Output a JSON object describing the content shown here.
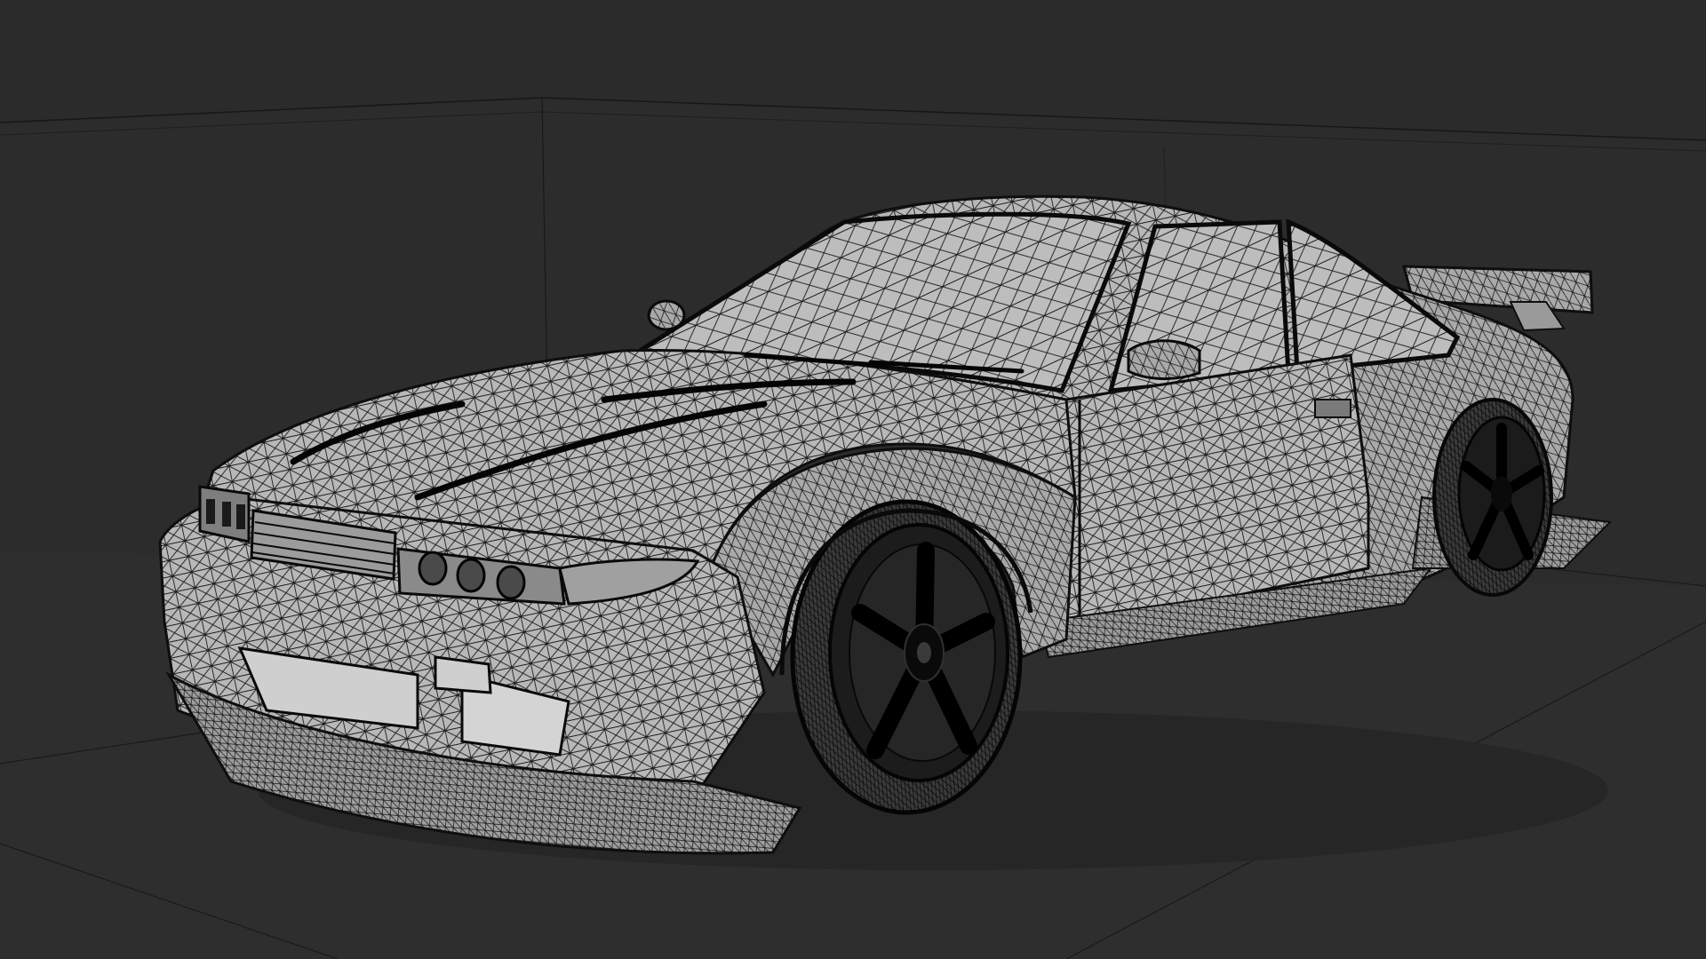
{
  "viewport": {
    "background_color": "#2b2b2b",
    "ground_color": "#2f2f2f",
    "grid_line_color": "#171717",
    "grid_minor_color": "#303030",
    "shading_mode": "wireframe-overlay-solid",
    "object": {
      "kind": "car-model",
      "body_color": "#b6b6b6",
      "wire_color": "#111111",
      "tire_color": "#1a1a1a",
      "rim_color": "#0d0d0d"
    }
  }
}
